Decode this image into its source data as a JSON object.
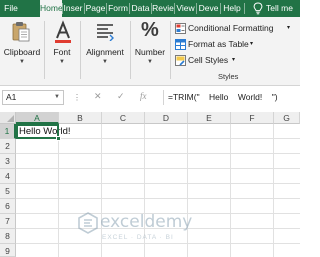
{
  "tabs": [
    "File",
    "Home",
    "Inser",
    "Page",
    "Form",
    "Data",
    "Revie",
    "View",
    "Deve",
    "Help"
  ],
  "active_tab": "Home",
  "tell_me": "Tell me",
  "ribbon": {
    "clipboard_label": "Clipboard",
    "font_label": "Font",
    "alignment_label": "Alignment",
    "number_label": "Number",
    "conditional_formatting": "Conditional Formatting",
    "format_as_table": "Format as Table",
    "cell_styles": "Cell Styles",
    "styles_group": "Styles",
    "percent_symbol": "%"
  },
  "formula_bar": {
    "name_box": "A1",
    "formula": "=TRIM(\"    Hello    World!    \")"
  },
  "grid": {
    "columns": [
      "A",
      "B",
      "C",
      "D",
      "E",
      "F",
      "G"
    ],
    "rows": [
      "1",
      "2",
      "3",
      "4",
      "5",
      "6",
      "7",
      "8",
      "9",
      "10"
    ],
    "selected_cell": "A1",
    "a1_value": "Hello World!"
  },
  "watermark": {
    "name": "exceldemy",
    "tagline": "EXCEL · DATA · BI"
  },
  "colors": {
    "accent": "#217346",
    "ribbon_bg": "#f3f3f3"
  }
}
